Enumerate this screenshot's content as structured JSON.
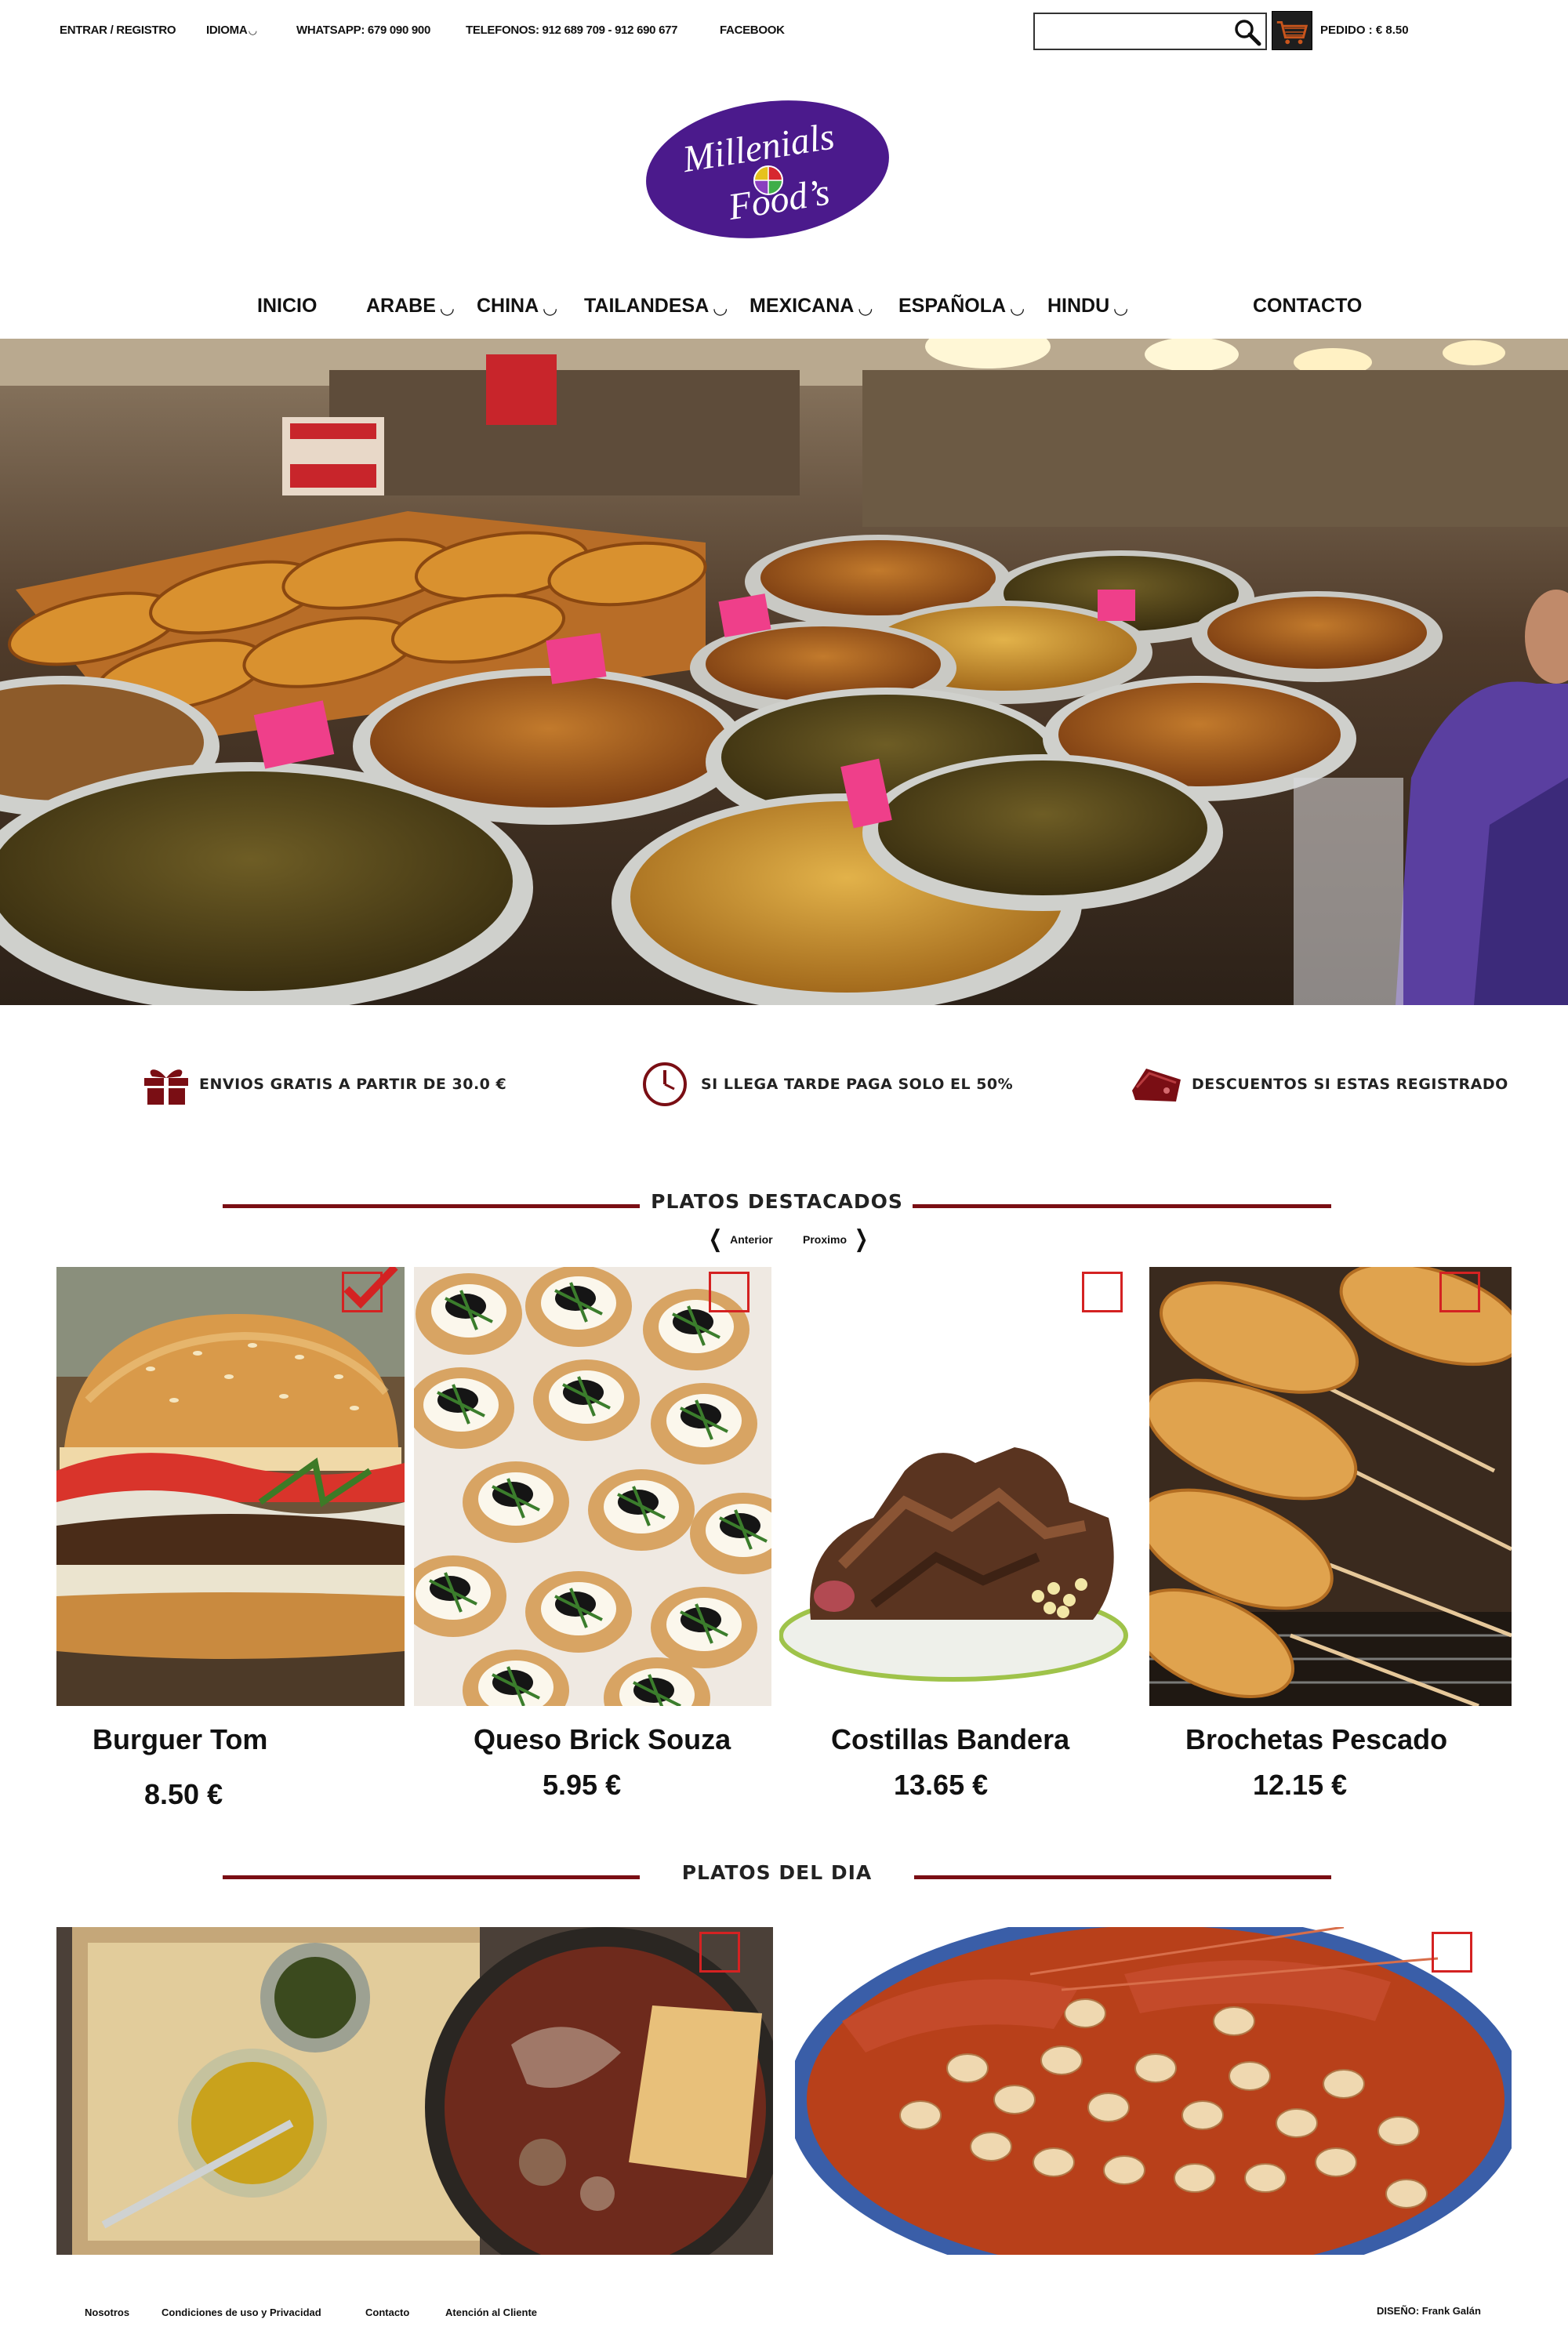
{
  "topbar": {
    "login": "ENTRAR / REGISTRO",
    "language": "IDIOMA",
    "whatsapp": "WHATSAPP: 679 090 900",
    "phones": "TELEFONOS: 912 689 709  - 912 690 677",
    "facebook": "FACEBOOK",
    "search_placeholder": "",
    "order_total": "PEDIDO : € 8.50"
  },
  "logo": {
    "line1": "Millenials",
    "line2": "Food’s",
    "color": "#4b1a8c"
  },
  "nav": {
    "items": [
      {
        "label": "INICIO"
      },
      {
        "label": "ARABE",
        "dropdown": true
      },
      {
        "label": "CHINA",
        "dropdown": true
      },
      {
        "label": "TAILANDESA",
        "dropdown": true
      },
      {
        "label": "MEXICANA",
        "dropdown": true
      },
      {
        "label": "ESPAÑOLA",
        "dropdown": true
      },
      {
        "label": "HINDU",
        "dropdown": true
      },
      {
        "label": "CONTACTO"
      }
    ]
  },
  "perks": [
    {
      "icon": "gift-icon",
      "text": "ENVIOS GRATIS A PARTIR DE  30.0 €"
    },
    {
      "icon": "clock-icon",
      "text": "SI LLEGA TARDE PAGA SOLO EL 50%"
    },
    {
      "icon": "wallet-icon",
      "text": "DESCUENTOS SI ESTAS REGISTRADO"
    }
  ],
  "featured": {
    "title": "PLATOS DESTACADOS",
    "prev": "Anterior",
    "next": "Proximo",
    "items": [
      {
        "name": "Burguer Tom",
        "price": "8.50 €",
        "selected": true
      },
      {
        "name": "Queso Brick Souza",
        "price": "5.95 €",
        "selected": false
      },
      {
        "name": "Costillas Bandera",
        "price": "13.65 €",
        "selected": false
      },
      {
        "name": "Brochetas Pescado",
        "price": "12.15 €",
        "selected": false
      }
    ]
  },
  "daily": {
    "title": "PLATOS DEL DIA"
  },
  "footer": {
    "links": [
      "Nosotros",
      "Condiciones de uso y Privacidad",
      "Contacto",
      "Atención al Cliente"
    ],
    "credit": "DISEÑO: Frank Galán"
  },
  "colors": {
    "accent": "#7a0e14",
    "check_red": "#d42222",
    "logo_purple": "#4b1a8c"
  }
}
